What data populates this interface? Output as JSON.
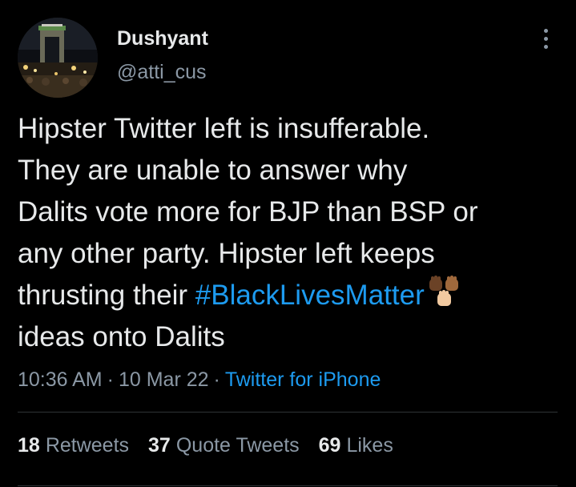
{
  "author": {
    "display_name": "Dushyant",
    "handle": "@atti_cus",
    "avatar": "india-gate-night-photo"
  },
  "more_icon": "more-vertical-icon",
  "tweet": {
    "lines": [
      "Hipster Twitter left is insufferable.",
      "They are unable to answer why",
      "Dalits vote more for BJP than BSP or",
      "any other party. Hipster left keeps"
    ],
    "line5_prefix": "thrusting their ",
    "hashtag": "#BlackLivesMatter",
    "emoji": "raised-fists-emoji",
    "line6": "ideas onto Dalits"
  },
  "meta": {
    "time": "10:36 AM",
    "separator": "·",
    "date": "10 Mar 22",
    "source": "Twitter for iPhone"
  },
  "stats": {
    "retweets_count": "18",
    "retweets_label": "Retweets",
    "quotes_count": "37",
    "quotes_label": "Quote Tweets",
    "likes_count": "69",
    "likes_label": "Likes"
  },
  "colors": {
    "background": "#000000",
    "text": "#e7e9ea",
    "secondary": "#8b98a5",
    "link": "#1d9bf0",
    "divider": "#2f3336"
  }
}
